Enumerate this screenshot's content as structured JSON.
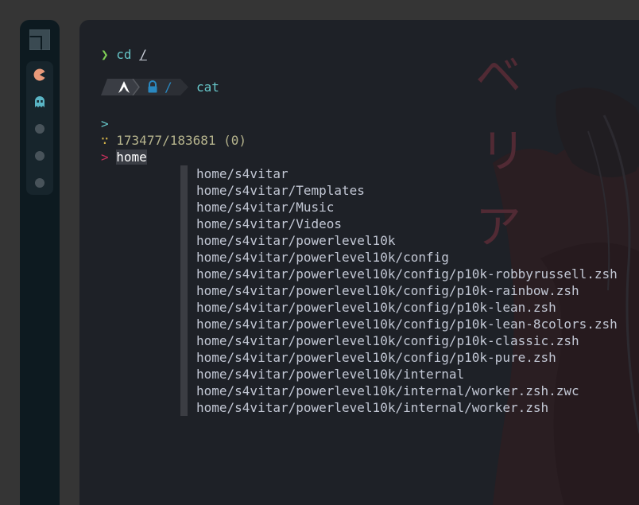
{
  "theme": {
    "background": "#353535",
    "dock": "#0d1a20",
    "terminal": "#1e2127",
    "prompt_green": "#7fcf55",
    "command_cyan": "#66c5c8",
    "fzf_pointer": "#c0305a",
    "fzf_info": "#d7b64a"
  },
  "dock": {
    "logo_icon": "window-logo-icon",
    "workspaces": [
      {
        "icon": "pacman-icon",
        "active": true
      },
      {
        "icon": "ghost-icon",
        "active": false
      },
      {
        "icon": "dot-icon",
        "active": false
      },
      {
        "icon": "dot-icon",
        "active": false
      },
      {
        "icon": "dot-icon",
        "active": false
      }
    ]
  },
  "wallpaper": {
    "kanji": [
      "ベ",
      "リ",
      "ア"
    ]
  },
  "terminal": {
    "line1": {
      "prompt": "❯",
      "command": "cd",
      "argument": "/"
    },
    "powerline": {
      "os_icon": "arch-linux-icon",
      "lock_icon": "lock-icon",
      "path": "/",
      "command": "cat"
    },
    "fzf": {
      "query_prompt": ">",
      "info_glyph": "∵",
      "count": "173477/183681 (0)",
      "pointer": ">",
      "selected": "home",
      "items": [
        "home/s4vitar",
        "home/s4vitar/Templates",
        "home/s4vitar/Music",
        "home/s4vitar/Videos",
        "home/s4vitar/powerlevel10k",
        "home/s4vitar/powerlevel10k/config",
        "home/s4vitar/powerlevel10k/config/p10k-robbyrussell.zsh",
        "home/s4vitar/powerlevel10k/config/p10k-rainbow.zsh",
        "home/s4vitar/powerlevel10k/config/p10k-lean.zsh",
        "home/s4vitar/powerlevel10k/config/p10k-lean-8colors.zsh",
        "home/s4vitar/powerlevel10k/config/p10k-classic.zsh",
        "home/s4vitar/powerlevel10k/config/p10k-pure.zsh",
        "home/s4vitar/powerlevel10k/internal",
        "home/s4vitar/powerlevel10k/internal/worker.zsh.zwc",
        "home/s4vitar/powerlevel10k/internal/worker.zsh"
      ]
    }
  }
}
